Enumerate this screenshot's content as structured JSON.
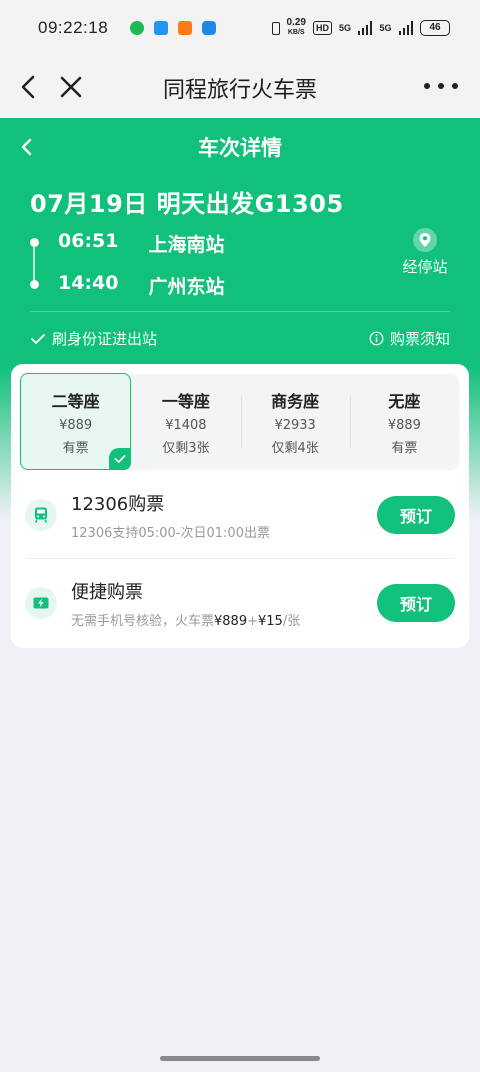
{
  "status_bar": {
    "time": "09:22:18",
    "speed_value": "0.29",
    "speed_unit": "KB/S",
    "hd": "HD",
    "net1": "5G",
    "net2": "5G",
    "battery": "46",
    "app_dot_colors": [
      "#1fb954",
      "#2196f3",
      "#ff7a1a",
      "#1e88e5"
    ]
  },
  "header": {
    "title": "同程旅行火车票"
  },
  "hero": {
    "title": "车次详情",
    "date_line": "07月19日 明天出发G1305",
    "depart_time": "06:51",
    "depart_station": "上海南站",
    "arrive_time": "14:40",
    "arrive_station": "广州东站",
    "stops_label": "经停站",
    "id_entry": "刷身份证进出站",
    "notice": "购票须知"
  },
  "seats": [
    {
      "name": "二等座",
      "price": "¥889",
      "avail": "有票",
      "selected": true
    },
    {
      "name": "一等座",
      "price": "¥1408",
      "avail": "仅剩3张",
      "selected": false
    },
    {
      "name": "商务座",
      "price": "¥2933",
      "avail": "仅剩4张",
      "selected": false
    },
    {
      "name": "无座",
      "price": "¥889",
      "avail": "有票",
      "selected": false
    }
  ],
  "booking": {
    "official": {
      "title": "12306购票",
      "sub": "12306支持05:00-次日01:00出票",
      "button": "预订"
    },
    "quick": {
      "title": "便捷购票",
      "sub_prefix": "无需手机号核验，火车票",
      "sub_price": "¥889",
      "sub_plus": "+",
      "sub_fee": "¥15",
      "sub_suffix": "/张",
      "button": "预订"
    }
  },
  "colors": {
    "brand_green": "#10c07b"
  }
}
